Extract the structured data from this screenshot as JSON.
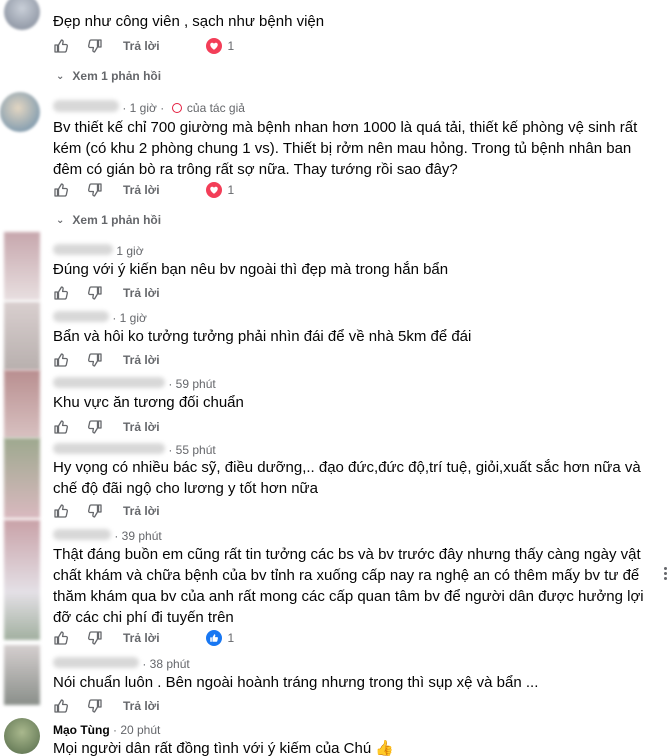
{
  "ui": {
    "reply_label": "Trả lời",
    "view_replies_label": "Xem 1 phản hồi",
    "author_label": "của tác giả"
  },
  "comments": [
    {
      "text": "Đẹp như công viên , sạch như bệnh viện",
      "reaction": "heart",
      "reaction_count": "1"
    },
    {
      "time": "1 giờ",
      "text": "Bv thiết kế chỉ 700 giường mà bệnh nhan hơn 1000 là quá tải, thiết kế phòng vệ sinh rất kém (có khu 2 phòng chung 1 vs). Thiết bị rởm nên mau hỏng. Trong tủ bệnh nhân ban đêm có gián bò ra trông rất sợ nữa. Thay tướng rồi sao đây?",
      "reaction": "heart",
      "reaction_count": "1"
    },
    {
      "time": "1 giờ",
      "text": "Đúng với ý kiến bạn nêu bv ngoài thì đẹp mà trong hắn bẩn"
    },
    {
      "time": "1 giờ",
      "text": "Bẩn và hôi ko tưởng tưởng phải nhìn đái để về nhà 5km để đái"
    },
    {
      "time": "59 phút",
      "text": "Khu vực ăn tương đối chuẩn"
    },
    {
      "time": "55 phút",
      "text": "Hy vọng có nhiều bác sỹ, điều dưỡng,.. đạo đức,đức độ,trí tuệ, giỏi,xuất sắc hơn nữa và chế độ đãi ngộ cho lương y tốt hơn nữa"
    },
    {
      "time": "39 phút",
      "text": "Thật đáng buồn em cũng rất tin tưởng các bs và bv trước đây nhưng thấy càng ngày vật chất khám và chữa bệnh của bv tỉnh ra xuống cấp nay ra nghệ an có thêm mấy bv tư để thăm khám qua bv của anh rất mong các cấp quan tâm bv để người dân được hưởng lợi đỡ các chi phí đi tuyến trên",
      "reaction": "like",
      "reaction_count": "1"
    },
    {
      "time": "38 phút",
      "text": "Nói chuẩn luôn . Bên ngoài hoành tráng nhưng trong thì sụp xệ và bẩn ..."
    },
    {
      "name": "Mạo Tùng",
      "time": "20 phút",
      "text": "Mọi người dân rất đồng tình với ý kiếm của Chú 👍"
    }
  ],
  "colors": {
    "text": "#050505",
    "muted": "#65676b",
    "heart": "#f33e58",
    "like": "#1877f2"
  },
  "icons": [
    "thumbs-up-icon",
    "thumbs-down-icon",
    "heart-reaction-icon",
    "like-reaction-icon",
    "chevron-down-icon",
    "more-options-icon"
  ]
}
